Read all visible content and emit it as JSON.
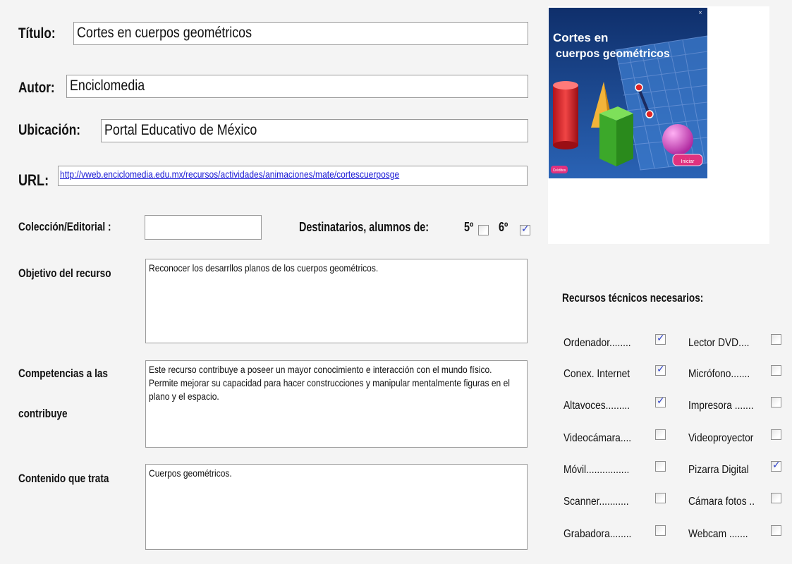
{
  "form": {
    "titulo": {
      "label": "Título:",
      "value": "Cortes en cuerpos geométricos"
    },
    "autor": {
      "label": "Autor:",
      "value": "Enciclomedia"
    },
    "ubicacion": {
      "label": "Ubicación:",
      "value": "Portal Educativo de México"
    },
    "url": {
      "label": "URL:",
      "value": "http://vweb.enciclomedia.edu.mx/recursos/actividades/animaciones/mate/cortescuerposge"
    },
    "coleccion": {
      "label": "Colección/Editorial :",
      "value": ""
    },
    "destinatarios": {
      "label": "Destinatarios, alumnos de:",
      "grade5": {
        "label": "5º",
        "checked": false
      },
      "grade6": {
        "label": "6º",
        "checked": true
      }
    },
    "objetivo": {
      "label": "Objetivo del recurso",
      "value": "Reconocer los desarrllos planos de los cuerpos geométricos."
    },
    "competencias": {
      "label_line1": "Competencias a las",
      "label_line2": "contribuye",
      "value": "Este recurso contribuye a poseer un mayor conocimiento e interacción con el mundo físico. Permite mejorar su capacidad para hacer construcciones y manipular mentalmente figuras en el plano y el espacio."
    },
    "contenido": {
      "label": "Contenido que trata",
      "value": "Cuerpos geométricos."
    }
  },
  "thumbnail": {
    "title_line1": "Cortes en",
    "title_line2": "cuerpos geométricos",
    "start_button": "Iniciar",
    "credits_button": "Créditos"
  },
  "recursos": {
    "heading": "Recursos técnicos necesarios:",
    "left": [
      {
        "label": "Ordenador........",
        "checked": true
      },
      {
        "label": "Conex. Internet",
        "checked": true
      },
      {
        "label": "Altavoces.........",
        "checked": true
      },
      {
        "label": "Videocámara....",
        "checked": false
      },
      {
        "label": "Móvil................",
        "checked": false
      },
      {
        "label": "Scanner...........",
        "checked": false
      },
      {
        "label": "Grabadora........",
        "checked": false
      }
    ],
    "right": [
      {
        "label": "Lector DVD....",
        "checked": false
      },
      {
        "label": "Micrófono.......",
        "checked": false
      },
      {
        "label": "Impresora .......",
        "checked": false
      },
      {
        "label": "Videoproyector",
        "checked": false
      },
      {
        "label": "Pizarra Digital",
        "checked": true
      },
      {
        "label": "Cámara fotos ..",
        "checked": false
      },
      {
        "label": "Webcam .......",
        "checked": false
      }
    ]
  },
  "colors": {
    "accent_check": "#2d40c8",
    "link": "#1a1ad6",
    "thumb_bg": "#1f4e92"
  }
}
